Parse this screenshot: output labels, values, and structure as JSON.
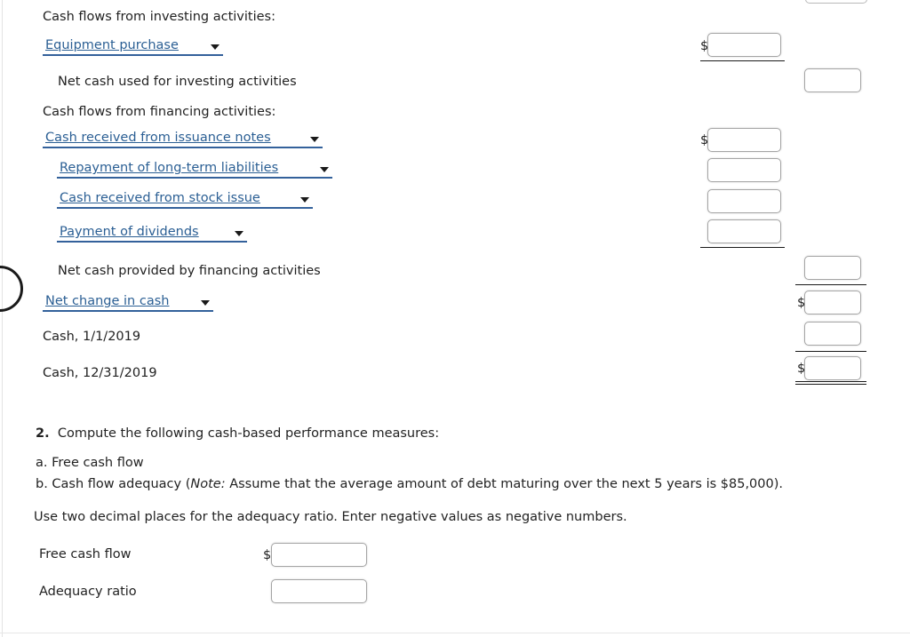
{
  "statement": {
    "investing_heading": "Cash flows from investing activities:",
    "investing_line_select": "Equipment purchase",
    "net_investing_label": "Net cash used for investing activities",
    "financing_heading": "Cash flows from financing activities:",
    "financing_selects": [
      "Cash received from issuance notes",
      "Repayment of long-term liabilities",
      "Cash received from stock issue",
      "Payment of dividends"
    ],
    "net_financing_label": "Net cash provided by financing activities",
    "net_change_select": "Net change in cash",
    "cash_begin_label": "Cash, 1/1/2019",
    "cash_end_label": "Cash, 12/31/2019",
    "currency_symbol": "$"
  },
  "question2": {
    "number": "2.",
    "prompt": "Compute the following cash-based performance measures:",
    "item_a": "a. Free cash flow",
    "item_b_prefix": "b. Cash flow adequacy (",
    "item_b_note": "Note:",
    "item_b_rest": " Assume that the average amount of debt maturing over the next 5 years is $85,000).",
    "instruction": "Use two decimal places for the adequacy ratio. Enter negative values as negative numbers.",
    "answer_rows": [
      {
        "label": "Free cash flow",
        "currency": "$",
        "value": ""
      },
      {
        "label": "Adequacy ratio",
        "currency": "",
        "value": ""
      }
    ]
  },
  "inputs": {
    "investing_amount": "",
    "net_investing_amount": "",
    "financing_amounts": [
      "",
      "",
      "",
      ""
    ],
    "net_financing_amount": "",
    "net_change_amount": "",
    "cash_begin_amount": "",
    "cash_end_amount": ""
  },
  "colors": {
    "select_text": "#2b5f94",
    "select_underline": "#33619b",
    "body_text": "#222222",
    "box_border": "#a5a5a5",
    "rule": "#1a1a1a",
    "page_background": "#ffffff"
  }
}
